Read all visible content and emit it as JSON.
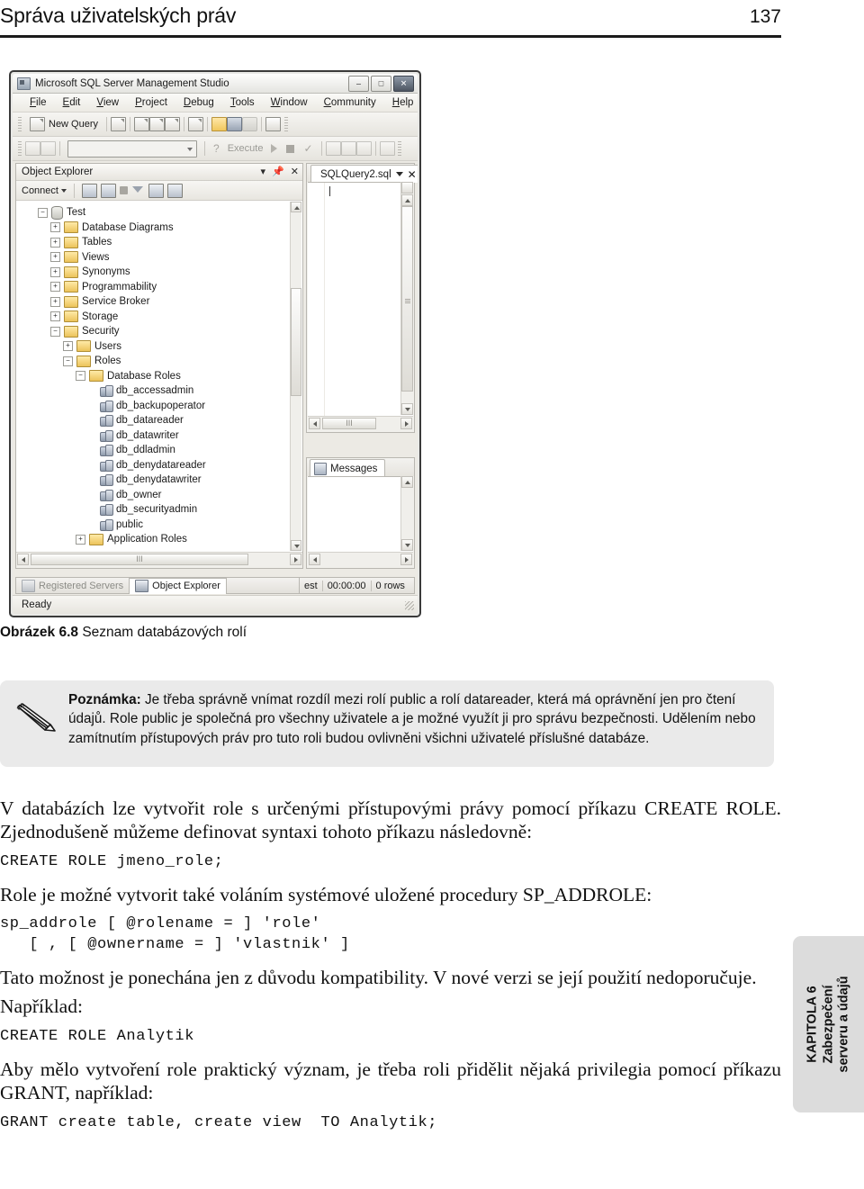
{
  "runhead": {
    "title": "Správa uživatelských práv",
    "page_number": "137"
  },
  "screenshot": {
    "window_title": "Microsoft SQL Server Management Studio",
    "window_buttons": {
      "minimize": "–",
      "maximize": "□",
      "close": "✕"
    },
    "menus": [
      "File",
      "Edit",
      "View",
      "Project",
      "Debug",
      "Tools",
      "Window",
      "Community",
      "Help"
    ],
    "toolbar": {
      "new_query_label": "New Query",
      "execute_label": "Execute",
      "combo_value": ""
    },
    "object_explorer": {
      "title": "Object Explorer",
      "connect_label": "Connect",
      "tree": [
        {
          "label": "Test",
          "indent": 1,
          "toggle": "minus",
          "icon": "database-icon"
        },
        {
          "label": "Database Diagrams",
          "indent": 2,
          "toggle": "plus",
          "icon": "folder-icon"
        },
        {
          "label": "Tables",
          "indent": 2,
          "toggle": "plus",
          "icon": "folder-icon"
        },
        {
          "label": "Views",
          "indent": 2,
          "toggle": "plus",
          "icon": "folder-icon"
        },
        {
          "label": "Synonyms",
          "indent": 2,
          "toggle": "plus",
          "icon": "folder-icon"
        },
        {
          "label": "Programmability",
          "indent": 2,
          "toggle": "plus",
          "icon": "folder-icon"
        },
        {
          "label": "Service Broker",
          "indent": 2,
          "toggle": "plus",
          "icon": "folder-icon"
        },
        {
          "label": "Storage",
          "indent": 2,
          "toggle": "plus",
          "icon": "folder-icon"
        },
        {
          "label": "Security",
          "indent": 2,
          "toggle": "minus",
          "icon": "folder-icon"
        },
        {
          "label": "Users",
          "indent": 3,
          "toggle": "plus",
          "icon": "folder-icon"
        },
        {
          "label": "Roles",
          "indent": 3,
          "toggle": "minus",
          "icon": "folder-icon"
        },
        {
          "label": "Database Roles",
          "indent": 4,
          "toggle": "minus",
          "icon": "folder-icon"
        },
        {
          "label": "db_accessadmin",
          "indent": 5,
          "toggle": "none",
          "icon": "role-icon"
        },
        {
          "label": "db_backupoperator",
          "indent": 5,
          "toggle": "none",
          "icon": "role-icon"
        },
        {
          "label": "db_datareader",
          "indent": 5,
          "toggle": "none",
          "icon": "role-icon"
        },
        {
          "label": "db_datawriter",
          "indent": 5,
          "toggle": "none",
          "icon": "role-icon"
        },
        {
          "label": "db_ddladmin",
          "indent": 5,
          "toggle": "none",
          "icon": "role-icon"
        },
        {
          "label": "db_denydatareader",
          "indent": 5,
          "toggle": "none",
          "icon": "role-icon"
        },
        {
          "label": "db_denydatawriter",
          "indent": 5,
          "toggle": "none",
          "icon": "role-icon"
        },
        {
          "label": "db_owner",
          "indent": 5,
          "toggle": "none",
          "icon": "role-icon"
        },
        {
          "label": "db_securityadmin",
          "indent": 5,
          "toggle": "none",
          "icon": "role-icon"
        },
        {
          "label": "public",
          "indent": 5,
          "toggle": "none",
          "icon": "role-icon"
        },
        {
          "label": "Application Roles",
          "indent": 4,
          "toggle": "plus",
          "icon": "folder-icon"
        }
      ]
    },
    "editor": {
      "tab_label": "SQLQuery2.sql",
      "close_glyph": "✕"
    },
    "messages": {
      "tab_label": "Messages"
    },
    "pane_tabs": [
      {
        "label": "Registered Servers",
        "selected": false
      },
      {
        "label": "Object Explorer",
        "selected": true
      }
    ],
    "query_status": {
      "connection": "est",
      "time": "00:00:00",
      "rows": "0 rows"
    },
    "statusbar": {
      "text": "Ready"
    }
  },
  "figure_caption": {
    "label": "Obrázek 6.8",
    "text": "Seznam databázových rolí"
  },
  "note": {
    "label": "Poznámka:",
    "text": " Je třeba správně vnímat rozdíl mezi rolí public a rolí datareader, která má oprávnění jen pro čtení údajů. Role public je společná pro všechny uživatele a je možné využít ji pro správu bezpečnosti. Udělením nebo zamítnutím přístupových práv pro tuto roli budou ovlivněni všichni uživatelé příslušné databáze."
  },
  "body": {
    "para1": "V databázích lze vytvořit role s určenými přístupovými právy pomocí příkazu CREATE ROLE. Zjednodušeně můžeme definovat syntaxi tohoto příkazu následovně:",
    "code1": "CREATE ROLE jmeno_role;",
    "para2": "Role je možné vytvorit také voláním systémové uložené procedury  SP_ADDROLE:",
    "code2": "sp_addrole [ @rolename = ] 'role'\n   [ , [ @ownername = ] 'vlastnik' ]",
    "para3": "Tato možnost je ponechána jen z důvodu kompatibility. V nové verzi se její použití nedoporučuje.",
    "para4": "Například:",
    "code3": "CREATE ROLE Analytik",
    "para5": "Aby mělo vytvoření role praktický význam, je třeba roli přidělit nějaká privilegia pomocí příkazu GRANT, například:",
    "code4": "GRANT create table, create view  TO Analytik;"
  },
  "sidetab": {
    "line1": "KAPITOLA 6",
    "line2": "Zabezpečení",
    "line3": "serveru a údajů"
  }
}
